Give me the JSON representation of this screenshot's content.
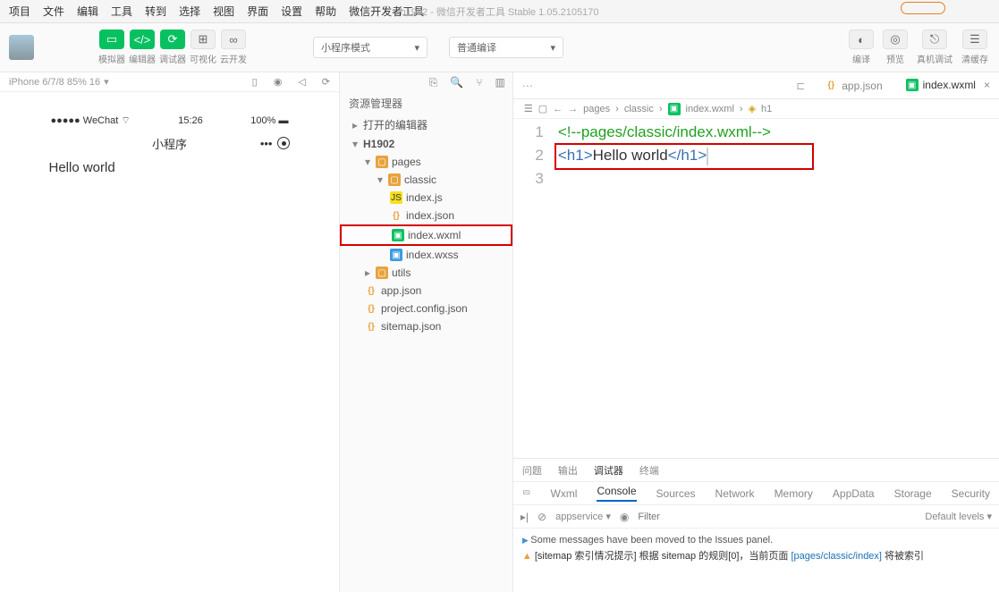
{
  "menu": [
    "项目",
    "文件",
    "编辑",
    "工具",
    "转到",
    "选择",
    "视图",
    "界面",
    "设置",
    "帮助",
    "微信开发者工具"
  ],
  "title": "h1902 - 微信开发者工具 Stable 1.05.2105170",
  "toolbar": {
    "sim": "模拟器",
    "edit": "编辑器",
    "debug": "调试器",
    "visual": "可视化",
    "cloud": "云开发",
    "mode": "小程序模式",
    "compile": "普通编译",
    "compile_btn": "编译",
    "preview": "预览",
    "remote": "真机调试",
    "cache": "清缓存"
  },
  "sim": {
    "header": "iPhone 6/7/8 85% 16",
    "status": {
      "left": "●●●●● WeChat",
      "wifi": "⌔",
      "time": "15:26",
      "right": "100%"
    },
    "nav_title": "小程序",
    "content": "Hello world"
  },
  "explorer": {
    "title": "资源管理器",
    "open_editors": "打开的编辑器",
    "project": "H1902",
    "tree": {
      "pages": "pages",
      "classic": "classic",
      "indexjs": "index.js",
      "indexjson": "index.json",
      "indexwxml": "index.wxml",
      "indexwxss": "index.wxss",
      "utils": "utils",
      "appjson": "app.json",
      "projectconfig": "project.config.json",
      "sitemap": "sitemap.json"
    }
  },
  "editor": {
    "tab1": "app.json",
    "tab2": "index.wxml",
    "breadcrumb": {
      "p": "pages",
      "c": "classic",
      "f": "index.wxml",
      "s": "h1"
    },
    "line1_comment": "<!--pages/classic/index.wxml-->",
    "line2_open": "<h1>",
    "line2_text": "Hello world",
    "line2_close": "</h1>"
  },
  "panel": {
    "tabs1": {
      "problem": "问题",
      "output": "输出",
      "debug": "调试器",
      "terminal": "终端"
    },
    "tabs2": [
      "Wxml",
      "Console",
      "Sources",
      "Network",
      "Memory",
      "AppData",
      "Storage",
      "Security"
    ],
    "appservice": "appservice",
    "filter_ph": "Filter",
    "levels": "Default levels ▾",
    "msg1": "Some messages have been moved to the Issues panel.",
    "msg2a": "[sitemap 索引情况提示] 根据 sitemap 的规则[0]，当前页面 ",
    "msg2b": "[pages/classic/index]",
    "msg2c": " 将被索引"
  }
}
